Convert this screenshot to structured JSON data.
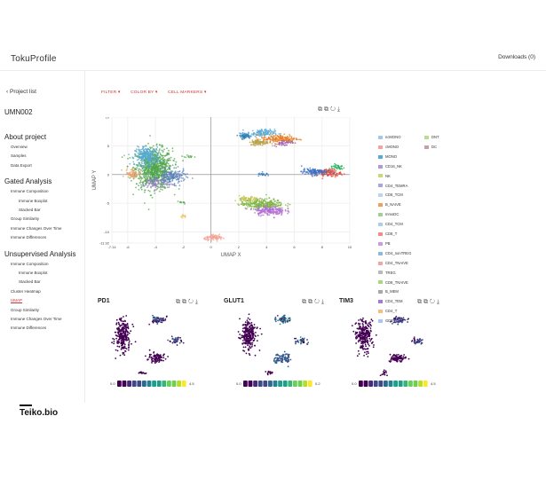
{
  "app": {
    "brand": "TokuProfile",
    "downloads": "Downloads (0)"
  },
  "sidebar": {
    "back": "Project list",
    "project": "UMN002",
    "sections": [
      {
        "title": "About project",
        "items": [
          {
            "label": "Overview",
            "level": 1
          },
          {
            "label": "Samples",
            "level": 1
          },
          {
            "label": "Data Export",
            "level": 1
          }
        ]
      },
      {
        "title": "Gated Analysis",
        "items": [
          {
            "label": "Immune Composition",
            "level": 1
          },
          {
            "label": "Immune Boxplot",
            "level": 2
          },
          {
            "label": "Stacked Bar",
            "level": 2
          },
          {
            "label": "Group Similarity",
            "level": 1
          },
          {
            "label": "Immune Changes Over Time",
            "level": 1
          },
          {
            "label": "Immune Differences",
            "level": 1
          }
        ]
      },
      {
        "title": "Unsupervised Analysis",
        "items": [
          {
            "label": "Immune Composition",
            "level": 1
          },
          {
            "label": "Immune Boxplot",
            "level": 2
          },
          {
            "label": "Stacked Bar",
            "level": 2
          },
          {
            "label": "Cluster Heatmap",
            "level": 1
          },
          {
            "label": "UMAP",
            "level": 1,
            "active": true
          },
          {
            "label": "Group Similarity",
            "level": 1
          },
          {
            "label": "Immune Changes Over Time",
            "level": 1
          },
          {
            "label": "Immune Differences",
            "level": 1
          }
        ]
      }
    ],
    "logo": "Teiko.bio"
  },
  "filters": {
    "filter": "FILTER ▾",
    "color_by": "COLOR BY ▾",
    "cell_markers": "CELL MARKERS ▾"
  },
  "chart_data": [
    {
      "type": "scatter",
      "xlabel": "UMAP X",
      "ylabel": "UMAP Y",
      "xlim": [
        -7.14,
        10
      ],
      "ylim": [
        -11.92,
        10
      ],
      "x_ticks": [
        "-7.14",
        "-6",
        "-4",
        "-2",
        "0",
        "2",
        "4",
        "6",
        "8",
        "10"
      ],
      "y_ticks": [
        "10",
        "5",
        "0",
        "-5",
        "-10",
        "-11.92"
      ],
      "grid": true,
      "legend_position": "right",
      "legend": [
        {
          "name": "ncMONO",
          "color": "#a6c8e8"
        },
        {
          "name": "DNT",
          "color": "#b5df8e"
        },
        {
          "name": "cMONO",
          "color": "#f4a29a"
        },
        {
          "name": "DC",
          "color": "#c7a0a0"
        },
        {
          "name": "MONO",
          "color": "#57a9d6"
        },
        {
          "name": "CD16_NK",
          "color": "#ad98d8"
        },
        {
          "name": "NK",
          "color": "#c8d97b"
        },
        {
          "name": "CD4_TEMRA",
          "color": "#a9a6dc"
        },
        {
          "name": "CD8_TCM",
          "color": "#bcd4f0"
        },
        {
          "name": "B_NAIVE",
          "color": "#eaa05a"
        },
        {
          "name": "mmoDC",
          "color": "#9fcf97"
        },
        {
          "name": "CD4_TCM",
          "color": "#a8cfe6"
        },
        {
          "name": "CD8_T",
          "color": "#f28b82"
        },
        {
          "name": "PB",
          "color": "#c99be0"
        },
        {
          "name": "CD4_nonTREG",
          "color": "#8fb9d9"
        },
        {
          "name": "CD4_TNAIVE",
          "color": "#f2a6a0"
        },
        {
          "name": "TREG",
          "color": "#b9b9b9"
        },
        {
          "name": "CD8_TNAIVE",
          "color": "#a5d87f"
        },
        {
          "name": "B_MEM",
          "color": "#a8a8a8"
        },
        {
          "name": "CD4_TEM",
          "color": "#9f7ad6"
        },
        {
          "name": "CD4_T",
          "color": "#f0c07c"
        },
        {
          "name": "GDT",
          "color": "#a9c7ec"
        }
      ],
      "clusters": [
        {
          "x": -4.1,
          "y": 1.0,
          "sx": 1.2,
          "sy": 3.2,
          "color": "#4fa64a",
          "n": 900
        },
        {
          "x": -4.6,
          "y": 3.2,
          "sx": 0.8,
          "sy": 1.4,
          "color": "#57a9d6",
          "n": 260
        },
        {
          "x": -4.0,
          "y": -1.5,
          "sx": 0.9,
          "sy": 0.9,
          "color": "#9f7ad6",
          "n": 80
        },
        {
          "x": -2.8,
          "y": -0.4,
          "sx": 0.9,
          "sy": 1.1,
          "color": "#5b7fc0",
          "n": 160
        },
        {
          "x": -5.6,
          "y": 0.2,
          "sx": 0.5,
          "sy": 0.8,
          "color": "#e8a36a",
          "n": 70
        },
        {
          "x": 3.6,
          "y": 7.2,
          "sx": 0.9,
          "sy": 0.6,
          "color": "#57a9d6",
          "n": 130
        },
        {
          "x": 5.0,
          "y": 6.2,
          "sx": 1.2,
          "sy": 0.7,
          "color": "#e67e22",
          "n": 180
        },
        {
          "x": 3.5,
          "y": 5.6,
          "sx": 0.6,
          "sy": 0.5,
          "color": "#b8a24a",
          "n": 90
        },
        {
          "x": 2.4,
          "y": 6.7,
          "sx": 0.4,
          "sy": 0.4,
          "color": "#2c7fb8",
          "n": 60
        },
        {
          "x": 5.2,
          "y": 5.5,
          "sx": 0.6,
          "sy": 0.5,
          "color": "#9b59b6",
          "n": 40
        },
        {
          "x": 8.5,
          "y": 0.3,
          "sx": 0.8,
          "sy": 0.6,
          "color": "#e74c3c",
          "n": 120
        },
        {
          "x": 7.4,
          "y": 0.5,
          "sx": 0.8,
          "sy": 0.5,
          "color": "#3b6fc4",
          "n": 120
        },
        {
          "x": 9.1,
          "y": 1.3,
          "sx": 0.5,
          "sy": 0.5,
          "color": "#27ae60",
          "n": 40
        },
        {
          "x": 3.7,
          "y": -5.1,
          "sx": 1.4,
          "sy": 0.8,
          "color": "#7cb342",
          "n": 280
        },
        {
          "x": 4.2,
          "y": -6.3,
          "sx": 1.0,
          "sy": 0.7,
          "color": "#b06bd6",
          "n": 180
        },
        {
          "x": 2.7,
          "y": -4.3,
          "sx": 0.6,
          "sy": 0.5,
          "color": "#c0c24a",
          "n": 60
        },
        {
          "x": 0.3,
          "y": -11.0,
          "sx": 0.7,
          "sy": 0.4,
          "color": "#f39c8c",
          "n": 70
        },
        {
          "x": 3.8,
          "y": 0.0,
          "sx": 0.4,
          "sy": 0.25,
          "color": "#3b7fc0",
          "n": 25
        },
        {
          "x": -2.0,
          "y": -7.3,
          "sx": 0.2,
          "sy": 0.3,
          "color": "#e8c24a",
          "n": 10
        },
        {
          "x": -1.6,
          "y": 3.1,
          "sx": 0.5,
          "sy": 0.2,
          "color": "#4fa64a",
          "n": 12
        },
        {
          "x": -2.1,
          "y": -4.9,
          "sx": 0.4,
          "sy": 0.2,
          "color": "#4fa64a",
          "n": 10
        }
      ]
    },
    {
      "type": "scatter",
      "title": "PD1",
      "colorbar": {
        "min": "0.0",
        "max": "4.5"
      }
    },
    {
      "type": "scatter",
      "title": "GLUT1",
      "colorbar": {
        "min": "0.0",
        "max": "0.2"
      }
    },
    {
      "type": "scatter",
      "title": "TIM3",
      "colorbar": {
        "min": "0.0",
        "max": "4.5"
      }
    }
  ]
}
